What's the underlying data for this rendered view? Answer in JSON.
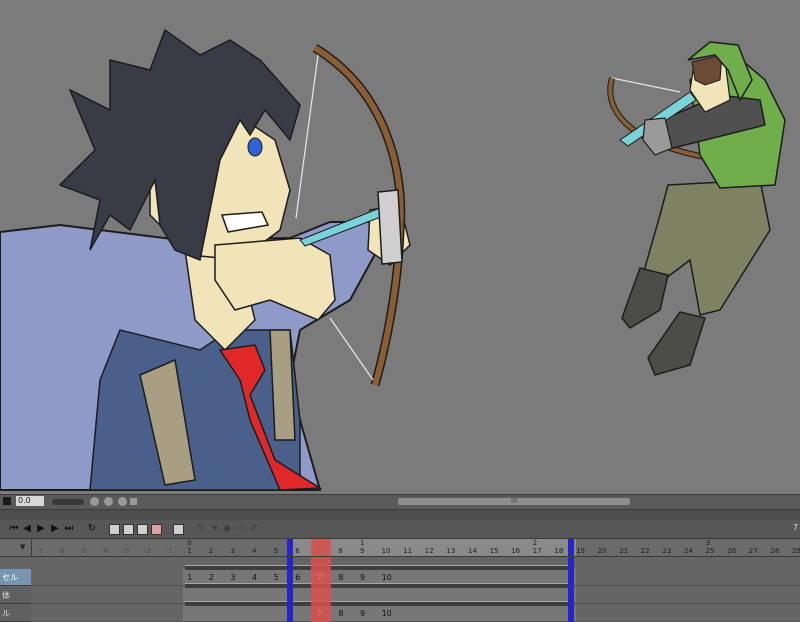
{
  "colors": {
    "canvas_bg": "#7b7b7b",
    "current_frame": "#d94d4d",
    "range_marker": "#2626c8",
    "active_track": "#7794b0"
  },
  "canvas": {
    "characters": [
      {
        "name": "dark-haired archer",
        "description_icon": "archer-drawing-icon"
      },
      {
        "name": "hooded archer",
        "description_icon": "archer-drawing-icon"
      }
    ]
  },
  "scrollbar": {
    "zoom_value": "0.0",
    "grip": "III"
  },
  "toolbar": {
    "buttons": [
      "first-frame",
      "prev-frame",
      "play",
      "next-frame",
      "last-frame",
      "loop",
      "new-cell",
      "new-camera",
      "new-folder",
      "delete",
      "settings",
      "edit",
      "onion",
      "keyframe",
      "draw"
    ],
    "end_frame_label": "7"
  },
  "ruler": {
    "second_labels": [
      {
        "label": "0",
        "frame_index": 7
      },
      {
        "label": "1",
        "frame_index": 15
      },
      {
        "label": "2",
        "frame_index": 23
      },
      {
        "label": "3",
        "frame_index": 31
      }
    ],
    "frames": [
      "-7",
      "-6",
      "-5",
      "-4",
      "-3",
      "-2",
      "-1",
      "1",
      "2",
      "3",
      "4",
      "5",
      "6",
      "7",
      "8",
      "9",
      "10",
      "11",
      "12",
      "13",
      "14",
      "15",
      "16",
      "17",
      "18",
      "19",
      "20",
      "21",
      "22",
      "23",
      "24",
      "25",
      "26",
      "27",
      "28",
      "29"
    ],
    "current_frame": "7",
    "range_start_marker": "6",
    "range_end_marker": "18"
  },
  "tracks": [
    {
      "label": "セル",
      "active": true,
      "cells": [
        "1",
        "2",
        "3",
        "4",
        "5",
        "6",
        "7",
        "8",
        "9",
        "10"
      ]
    },
    {
      "label": "体",
      "active": false,
      "cells": []
    },
    {
      "label": "ル",
      "active": false,
      "cells": [
        "7",
        "8",
        "9",
        "10"
      ]
    }
  ]
}
